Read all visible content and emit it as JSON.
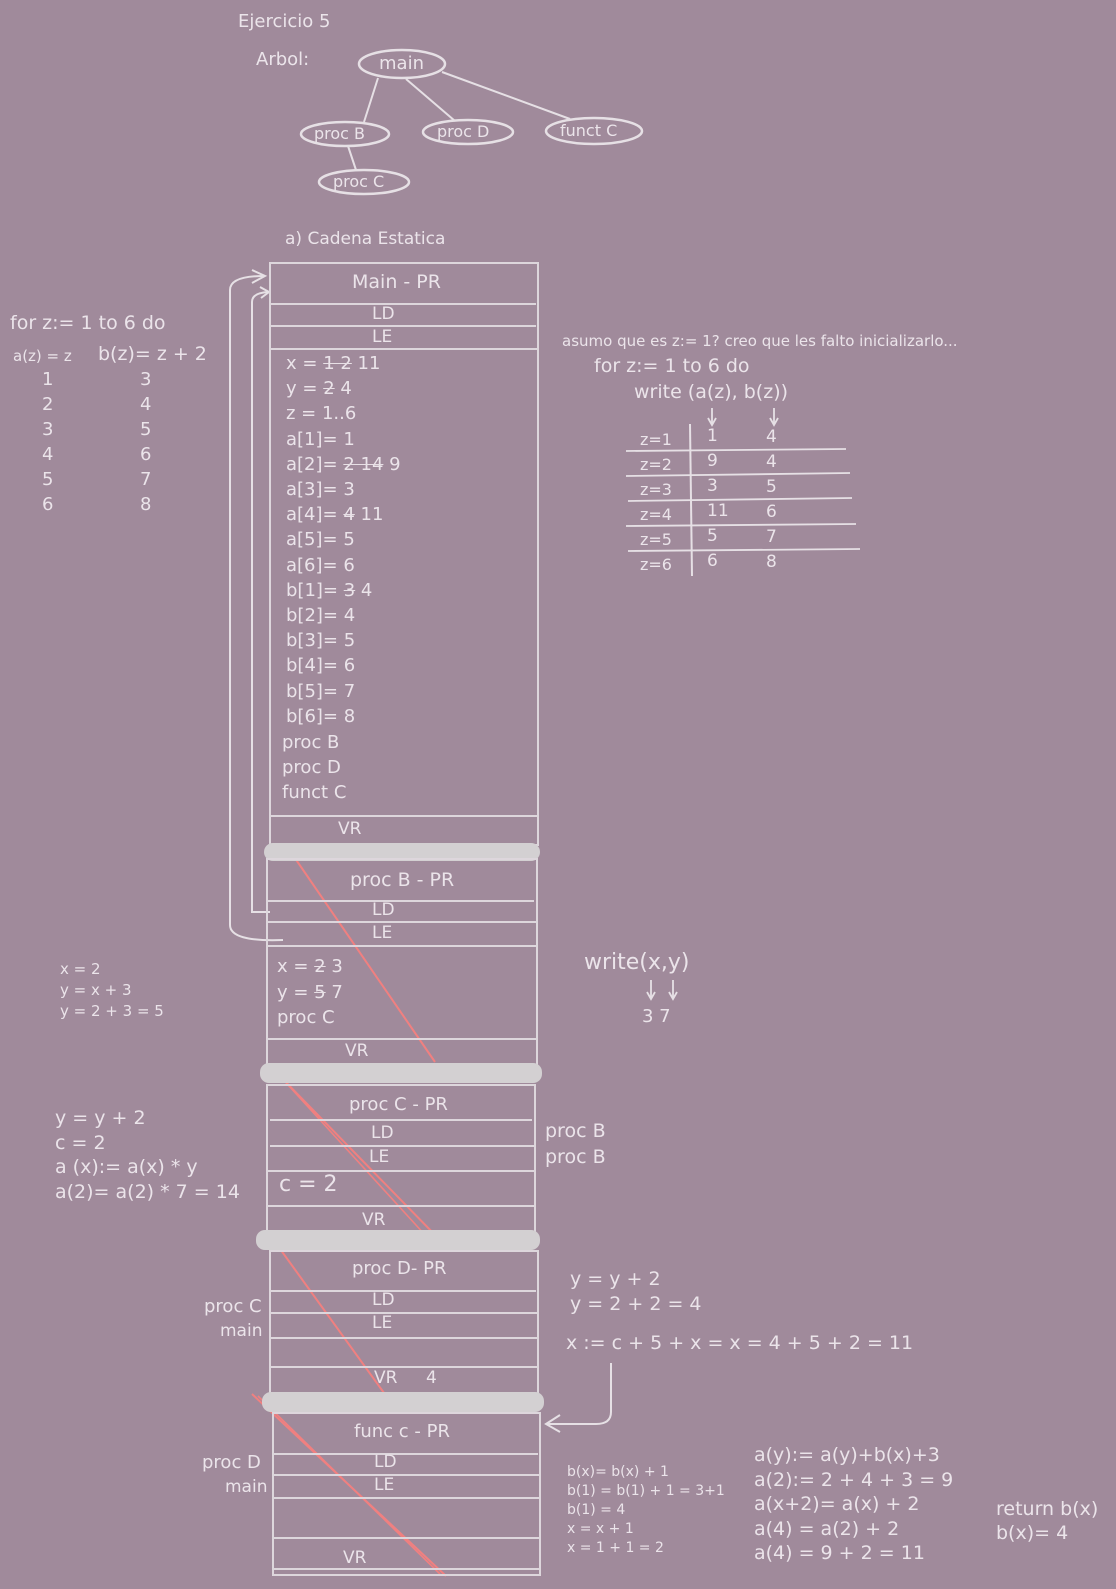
{
  "title": "Ejercicio 5",
  "tree": {
    "label": "Arbol:",
    "nodes": {
      "main": "main",
      "procB": "proc B",
      "procD": "proc D",
      "functC": "funct C",
      "procC": "proc C"
    }
  },
  "section_title": "a) Cadena Estatica",
  "left_loop": {
    "header": "for z:= 1 to 6 do",
    "col1": "a(z) = z",
    "col2": "b(z)= z + 2",
    "rows": [
      [
        "1",
        "3"
      ],
      [
        "2",
        "4"
      ],
      [
        "3",
        "5"
      ],
      [
        "4",
        "6"
      ],
      [
        "5",
        "7"
      ],
      [
        "6",
        "8"
      ]
    ]
  },
  "main_frame": {
    "title": "Main - PR",
    "ld": "LD",
    "le": "LE",
    "vars": [
      {
        "pre": "x = ",
        "struck": "1  2",
        "post": "  11"
      },
      {
        "pre": "y = ",
        "struck": "2",
        "post": "  4"
      },
      {
        "pre": "z = 1..6",
        "struck": "",
        "post": ""
      },
      {
        "pre": "a[1]= 1",
        "struck": "",
        "post": ""
      },
      {
        "pre": "a[2]= ",
        "struck": "2 14",
        "post": " 9"
      },
      {
        "pre": "a[3]= 3",
        "struck": "",
        "post": ""
      },
      {
        "pre": "a[4]= ",
        "struck": "4",
        "post": " 11"
      },
      {
        "pre": "a[5]= 5",
        "struck": "",
        "post": ""
      },
      {
        "pre": "a[6]= 6",
        "struck": "",
        "post": ""
      },
      {
        "pre": "b[1]= ",
        "struck": "3",
        "post": "  4"
      },
      {
        "pre": "b[2]= 4",
        "struck": "",
        "post": ""
      },
      {
        "pre": "b[3]= 5",
        "struck": "",
        "post": ""
      },
      {
        "pre": "b[4]= 6",
        "struck": "",
        "post": ""
      },
      {
        "pre": "b[5]= 7",
        "struck": "",
        "post": ""
      },
      {
        "pre": "b[6]= 8",
        "struck": "",
        "post": ""
      }
    ],
    "procs": [
      "proc B",
      "proc D",
      "funct C"
    ],
    "vr": "VR"
  },
  "right_note": {
    "assume": "asumo que es z:= 1? creo que les falto inicializarlo...",
    "loop": "for z:= 1 to 6 do",
    "write": "write (a(z), b(z))",
    "rows": [
      [
        "z=1",
        "1",
        "4"
      ],
      [
        "z=2",
        "9",
        "4"
      ],
      [
        "z=3",
        "3",
        "5"
      ],
      [
        "z=4",
        "11",
        "6"
      ],
      [
        "z=5",
        "5",
        "7"
      ],
      [
        "z=6",
        "6",
        "8"
      ]
    ]
  },
  "procB_frame": {
    "title": "proc B - PR",
    "ld": "LD",
    "le": "LE",
    "x": {
      "pre": "x = ",
      "struck": "2",
      "post": " 3"
    },
    "y": {
      "pre": "y = ",
      "struck": "5",
      "post": " 7"
    },
    "call": "proc C",
    "vr": "VR"
  },
  "procB_notes": [
    "x = 2",
    "y = x + 3",
    "y = 2 + 3 = 5"
  ],
  "procB_write": {
    "call": "write(x,y)",
    "out": "3  7"
  },
  "procC_frame": {
    "title": "proc C - PR",
    "ld": "LD",
    "le": "LE",
    "body": "c = 2",
    "vr": "VR",
    "ld_target": "proc B",
    "le_target": "proc B"
  },
  "procC_notes": [
    "y = y + 2",
    "c = 2",
    "a (x):= a(x) * y",
    "a(2)= a(2) * 7 = 14"
  ],
  "procD_frame": {
    "title": "proc D- PR",
    "ld": "LD",
    "le": "LE",
    "vr": "VR",
    "vr_value": "4",
    "ld_target": "proc C",
    "le_target": "main"
  },
  "procD_notes": [
    "y = y + 2",
    "y = 2 + 2 = 4",
    "x := c + 5 + x = x = 4 + 5 + 2 = 11"
  ],
  "funcC_frame": {
    "title": "func c - PR",
    "ld": "LD",
    "le": "LE",
    "vr": "VR",
    "ld_target": "proc D",
    "le_target": "main"
  },
  "funcC_notes_b": [
    "b(x)= b(x) + 1",
    "b(1) = b(1) + 1 = 3+1",
    "b(1) = 4",
    "x = x + 1",
    "x = 1 + 1 = 2"
  ],
  "funcC_notes_a": [
    "a(y):= a(y)+b(x)+3",
    "a(2):= 2 + 4 + 3 = 9",
    "a(x+2)= a(x) + 2",
    "a(4) = a(2) + 2",
    "a(4) = 9 + 2 = 11"
  ],
  "funcC_return": [
    "return b(x)",
    "b(x)= 4"
  ]
}
